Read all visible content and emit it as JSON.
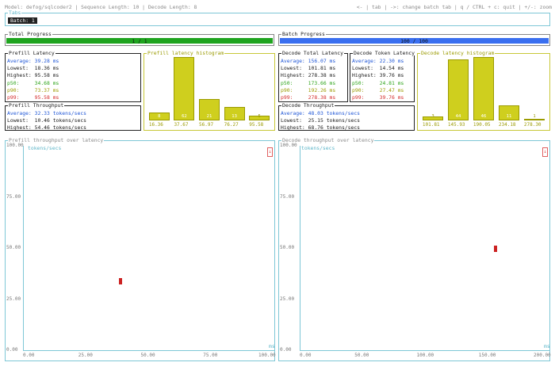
{
  "header": {
    "left": "Model: defog/sqlcoder2 | Sequence Length: 10 | Decode Length: 8",
    "right": "<- | tab | ->: change batch tab | q / CTRL + c: quit | +/-: zoom"
  },
  "tabs": {
    "title": "Tabs",
    "active": "Batch: 1"
  },
  "total_progress": {
    "title": "Total Progress",
    "text": "1 / 1",
    "fraction": 1.0,
    "color": "#1fa41f"
  },
  "batch_progress": {
    "title": "Batch Progress",
    "text": "100 / 100",
    "fraction": 1.0,
    "color": "#3a6ff0"
  },
  "prefill_latency": {
    "title": "Prefill Latency",
    "average": "Average: 39.28 ms",
    "lowest": "Lowest:  18.36 ms",
    "highest": "Highest: 95.58 ms",
    "p50": "p50:     34.68 ms",
    "p90": "p90:     73.37 ms",
    "p99": "p99:     95.58 ms"
  },
  "prefill_histogram": {
    "title": "Prefill latency histogram",
    "bars": [
      {
        "count": "8",
        "value": 8
      },
      {
        "count": "62",
        "value": 62
      },
      {
        "count": "21",
        "value": 21
      },
      {
        "count": "13",
        "value": 13
      },
      {
        "count": "5",
        "value": 5
      }
    ],
    "max": 62,
    "labels": [
      "16.36",
      "37.67",
      "56.97",
      "76.27",
      "95.58"
    ]
  },
  "prefill_throughput": {
    "title": "Prefill Throughput",
    "average": "Average: 32.33 tokens/secs",
    "lowest": "Lowest:  10.46 tokens/secs",
    "highest": "Highest: 54.46 tokens/secs"
  },
  "decode_total_latency": {
    "title": "Decode Total Latency",
    "average": "Average: 156.07 ms",
    "lowest": "Lowest:  101.81 ms",
    "highest": "Highest: 278.38 ms",
    "p50": "p50:     173.66 ms",
    "p90": "p90:     192.26 ms",
    "p99": "p99:     278.38 ms"
  },
  "decode_token_latency": {
    "title": "Decode Token Latency",
    "average": "Average: 22.30 ms",
    "lowest": "Lowest:  14.54 ms",
    "highest": "Highest: 39.76 ms",
    "p50": "p50:     24.81 ms",
    "p90": "p90:     27.47 ms",
    "p99": "p99:     39.76 ms"
  },
  "decode_histogram": {
    "title": "Decode latency histogram",
    "bars": [
      {
        "count": "3",
        "value": 3
      },
      {
        "count": "44",
        "value": 44
      },
      {
        "count": "46",
        "value": 46
      },
      {
        "count": "11",
        "value": 11
      },
      {
        "count": "1",
        "value": 1
      }
    ],
    "max": 46,
    "labels": [
      "101.81",
      "145.93",
      "190.05",
      "234.18",
      "278.30"
    ]
  },
  "decode_throughput": {
    "title": "Decode Throughput",
    "average": "Average: 48.03 tokens/secs",
    "lowest": "Lowest:  25.15 tokens/secs",
    "highest": "Highest: 68.76 tokens/secs"
  },
  "prefill_scatter": {
    "title": "Prefill throughput over latency",
    "ylabel": "tokens/secs",
    "xlabel": "ms",
    "yticks": [
      "100.00",
      "75.00",
      "50.00",
      "25.00",
      "0.00"
    ],
    "xticks": [
      "0.00",
      "25.00",
      "50.00",
      "75.00",
      "100.00"
    ],
    "xlim": [
      0,
      100
    ],
    "ylim": [
      0,
      100
    ],
    "points": [
      {
        "x": 38.5,
        "y": 34
      }
    ]
  },
  "decode_scatter": {
    "title": "Decode throughput over latency",
    "ylabel": "tokens/secs",
    "xlabel": "ms",
    "yticks": [
      "100.00",
      "75.00",
      "50.00",
      "25.00",
      "0.00"
    ],
    "xticks": [
      "0.00",
      "50.00",
      "100.00",
      "150.00",
      "200.00"
    ],
    "xlim": [
      0,
      200
    ],
    "ylim": [
      0,
      100
    ],
    "points": [
      {
        "x": 156,
        "y": 50
      }
    ]
  },
  "colors": {
    "cyan_border": "#7ec7d6",
    "yellow_border": "#c8c838"
  }
}
